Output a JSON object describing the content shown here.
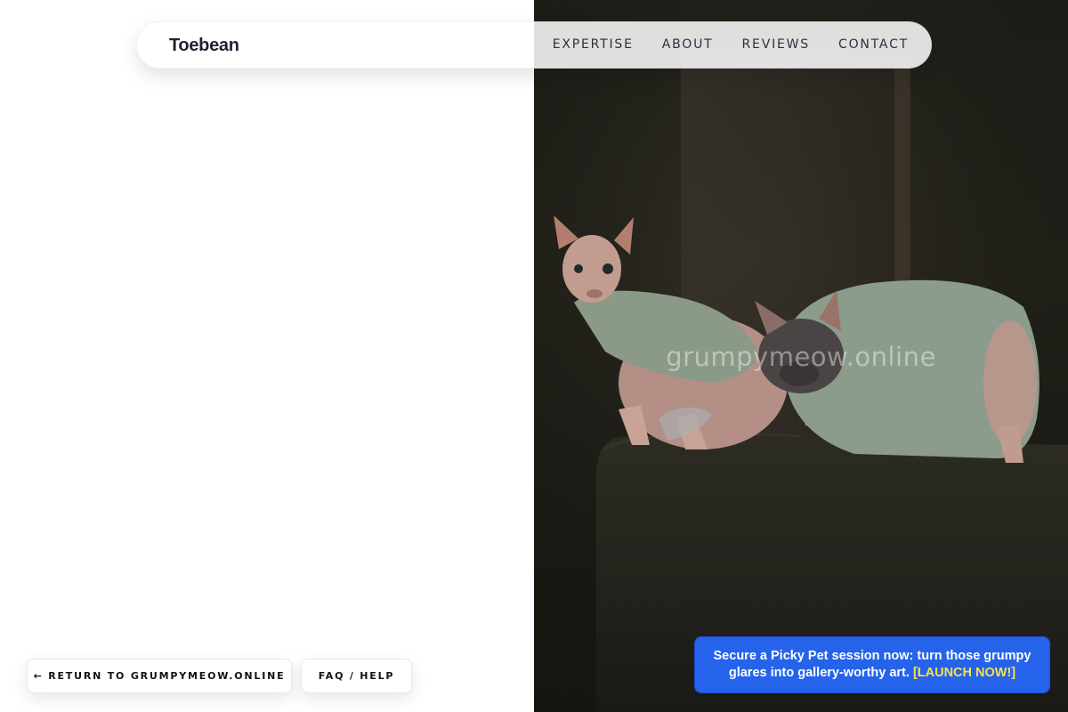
{
  "brand": "Toebean",
  "nav": {
    "items": [
      {
        "label": "EXPERTISE"
      },
      {
        "label": "ABOUT"
      },
      {
        "label": "REVIEWS"
      },
      {
        "label": "CONTACT"
      }
    ]
  },
  "hero": {
    "watermark": "grumpymeow.online",
    "image_subject": "two hairless cats in knit sweaters on a sofa"
  },
  "footer": {
    "return_label": "← RETURN TO GRUMPYMEOW.ONLINE",
    "faq_label": "FAQ / HELP"
  },
  "promo": {
    "text": "Secure a Picky Pet session now: turn those grumpy glares into gallery-worthy art.",
    "cta": "[LAUNCH NOW!]",
    "background": "#2563eb",
    "cta_color": "#fde047"
  }
}
